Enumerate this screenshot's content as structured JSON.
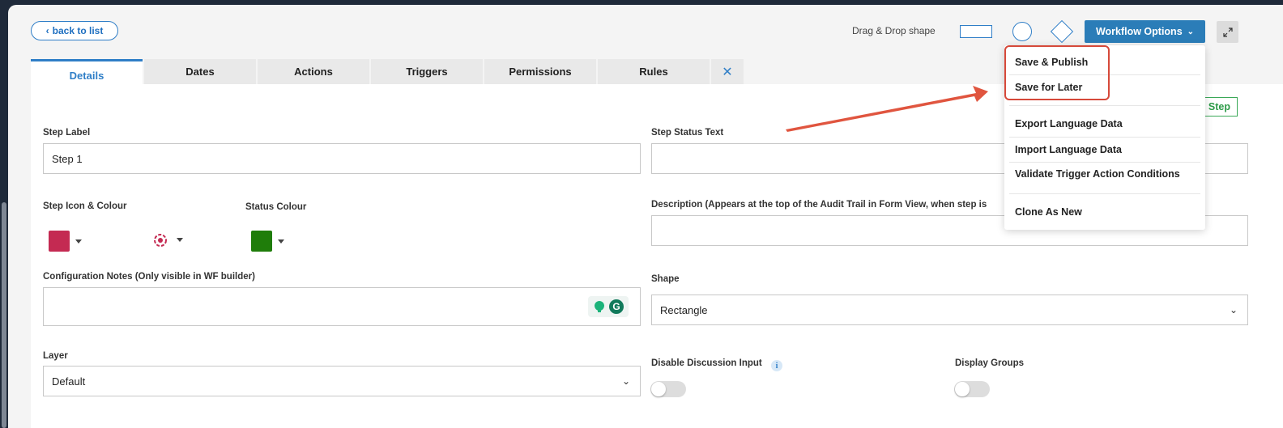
{
  "toolbar": {
    "back_label": "back to list",
    "drag_drop_label": "Drag & Drop shape",
    "workflow_options_label": "Workflow Options"
  },
  "tabs": [
    {
      "label": "Details"
    },
    {
      "label": "Dates"
    },
    {
      "label": "Actions"
    },
    {
      "label": "Triggers"
    },
    {
      "label": "Permissions"
    },
    {
      "label": "Rules"
    },
    {
      "label": "✕"
    }
  ],
  "step_button_label": "Step",
  "form": {
    "step_label": {
      "label": "Step Label",
      "value": "Step 1"
    },
    "step_status_text": {
      "label": "Step Status Text",
      "value": ""
    },
    "step_icon_colour": {
      "label": "Step Icon & Colour",
      "color": "#c42a52"
    },
    "status_colour": {
      "label": "Status Colour",
      "color": "#1f7d0a"
    },
    "description": {
      "label": "Description (Appears at the top of the Audit Trail in Form View, when step is",
      "value": ""
    },
    "configuration_notes": {
      "label": "Configuration Notes (Only visible in WF builder)",
      "value": ""
    },
    "shape": {
      "label": "Shape",
      "value": "Rectangle"
    },
    "layer": {
      "label": "Layer",
      "value": "Default"
    },
    "disable_discussion": {
      "label": "Disable Discussion Input",
      "enabled": false
    },
    "display_groups": {
      "label": "Display Groups",
      "enabled": false
    }
  },
  "menu": {
    "items": [
      {
        "label": "Save & Publish"
      },
      {
        "label": "Save for Later"
      },
      {
        "label": "Export Language Data"
      },
      {
        "label": "Import Language Data"
      },
      {
        "label": "Validate Trigger Action Conditions"
      },
      {
        "label": "Clone As New"
      }
    ]
  },
  "colors": {
    "accent": "#2f7ec7",
    "highlight": "#d6493a",
    "icon_color": "#c42a52",
    "status_color": "#1f7d0a"
  }
}
